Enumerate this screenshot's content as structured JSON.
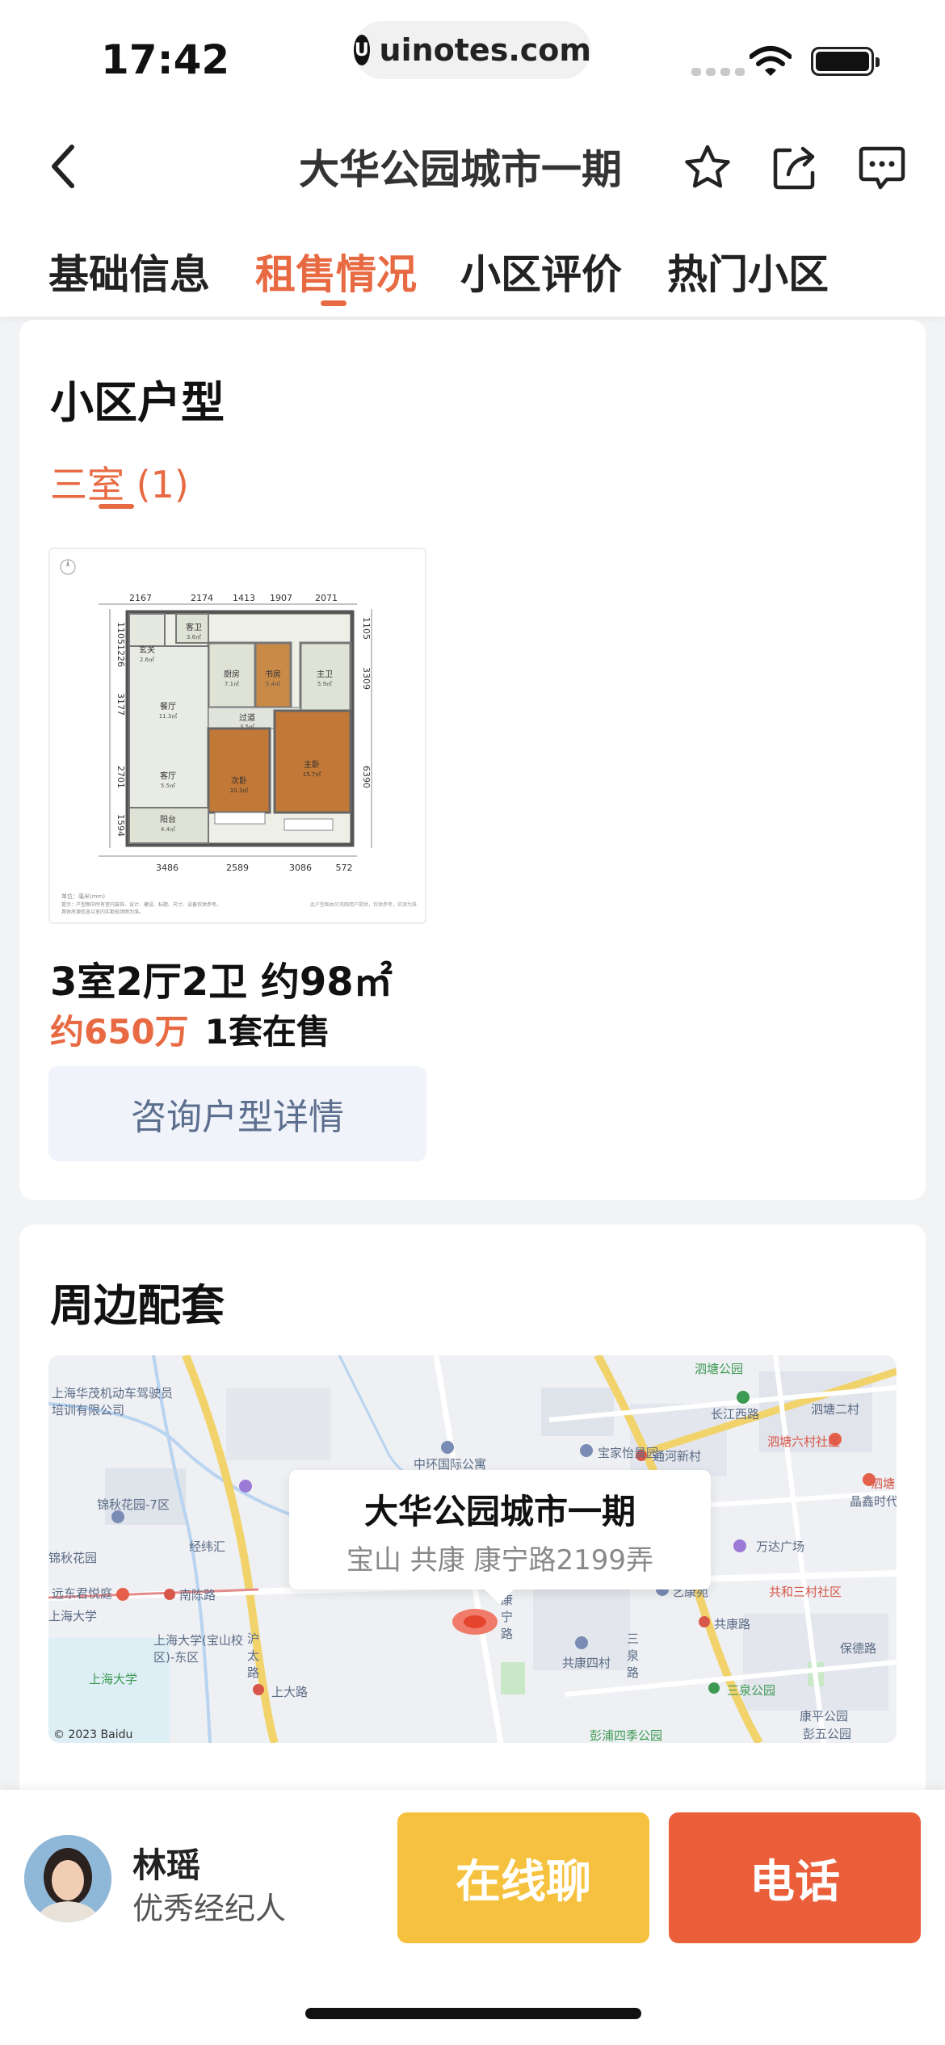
{
  "status_bar": {
    "time": "17:42",
    "url": "uinotes.com",
    "url_icon_glyph": "U"
  },
  "nav": {
    "title": "大华公园城市一期",
    "icons": [
      "back-icon",
      "star-icon",
      "share-icon",
      "message-icon"
    ]
  },
  "tabs": [
    {
      "label": "基础信息",
      "active": false
    },
    {
      "label": "租售情况",
      "active": true
    },
    {
      "label": "小区评价",
      "active": false
    },
    {
      "label": "热门小区",
      "active": false
    }
  ],
  "layout_section": {
    "title": "小区户型",
    "type_tab": "三室 (1)",
    "floorplan": {
      "top_dims": [
        "2167",
        "2174",
        "1413",
        "1907",
        "2071"
      ],
      "bottom_dims": [
        "3486",
        "2589",
        "3086",
        "572"
      ],
      "left_dims": [
        "1105",
        "1226",
        "3177",
        "2701",
        "1594"
      ],
      "right_dims": [
        "1105",
        "3309",
        "6390"
      ],
      "rooms": [
        {
          "name": "客卫",
          "area": "3.6㎡"
        },
        {
          "name": "玄关",
          "area": "2.6㎡"
        },
        {
          "name": "厨房",
          "area": "7.1㎡"
        },
        {
          "name": "书房",
          "area": "5.4㎡"
        },
        {
          "name": "主卫",
          "area": "5.9㎡"
        },
        {
          "name": "餐厅",
          "area": "11.3㎡"
        },
        {
          "name": "过道",
          "area": "3.5㎡"
        },
        {
          "name": "客厅",
          "area": "5.5㎡"
        },
        {
          "name": "次卧",
          "area": "10.3㎡"
        },
        {
          "name": "主卧",
          "area": "15.7㎡"
        },
        {
          "name": "阳台",
          "area": "4.4㎡"
        }
      ],
      "unit_note": "单位：毫米(mm)",
      "disclaimer": "提示：户型图中所有室内装饰、设计、建设、标题、尺寸、设备仅供参考。",
      "disclaimer2": "具体房源信息以室内实勘现场图为准。",
      "watermark": "此户型图由贝壳网用户提供，仅供参考，实测为准"
    },
    "unit_desc": "3室2厅2卫 约98㎡",
    "price": "约650万",
    "on_sale": "1套在售",
    "consult_button": "咨询户型详情"
  },
  "nearby_section": {
    "title": "周边配套",
    "map": {
      "popup_title": "大华公园城市一期",
      "popup_address": "宝山 共康 康宁路2199弄",
      "copyright": "© 2023 Baidu",
      "labels": {
        "l1": "上海华茂机动车驾驶员培训有限公司",
        "l2": "泗塘公园",
        "l3": "长江西路",
        "l4": "泗塘二村",
        "l5": "泗塘六村社区",
        "l6": "中环国际公寓",
        "l7": "宝家怡景园",
        "l8": "通河新村",
        "l9": "锦秋花园-7区",
        "l10": "锦秋花园",
        "l11": "经纬汇",
        "l12": "远东君悦庭",
        "l13": "南陈路",
        "l14": "上海大学",
        "l15": "沪太路",
        "l16": "上海大学(宝山校区)-东区",
        "l17": "上大路",
        "l18": "康宁路",
        "l19": "艺康苑",
        "l20": "共康路",
        "l21": "共康四村",
        "l22": "三泉路",
        "l23": "三泉公园",
        "l24": "彭浦四季公园",
        "l25": "康平公园",
        "l26": "彭五公园",
        "l27": "共和三村社区",
        "l28": "万达广场",
        "l29": "晶鑫时代",
        "l30": "保德路",
        "l31": "泗塘",
        "l32": "上海大学"
      }
    }
  },
  "agent": {
    "name": "林瑶",
    "role": "优秀经纪人"
  },
  "actions": {
    "chat_label": "在线聊",
    "call_label": "电话"
  },
  "colors": {
    "accent": "#e86a42",
    "chat_button": "#f6c13e",
    "call_button": "#ea5f3a",
    "consult_text": "#5d6f8e"
  }
}
